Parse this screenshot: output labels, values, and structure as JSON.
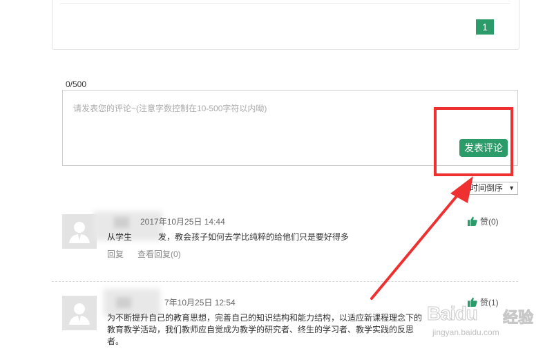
{
  "pagination": {
    "current_page": "1"
  },
  "comment_form": {
    "char_count": "0/500",
    "placeholder": "请发表您的评论~(注意字数控制在10-500字符以内呦)",
    "submit_label": "发表评论"
  },
  "sort": {
    "selected": "时间倒序"
  },
  "comments": [
    {
      "time": "2017年10月25日 14:44",
      "text_part1": "从学生",
      "text_part2": "发，教会孩子如何去学比纯粹的给他们只是要好得多",
      "reply_label": "回复",
      "view_replies_label": "查看回复(0)",
      "like_label": "赞(0)"
    },
    {
      "time": "7年10月25日 12:54",
      "text_line1": "为不断提升自己的教育思想，完善自己的知识结构和能力结构，以适应新课程理念下的",
      "text_line2": "教育教学活动，我们教师应自觉成为教学的研究者、终生的学习者、教学实践的反思",
      "text_line3": "者。",
      "like_label": "赞(1)"
    }
  ],
  "watermark": {
    "brand": "Baidu",
    "brand_cn": "经验",
    "url": "jingyan.baidu.com"
  },
  "colors": {
    "accent": "#2b9b6a",
    "annotation": "#ee3030"
  }
}
